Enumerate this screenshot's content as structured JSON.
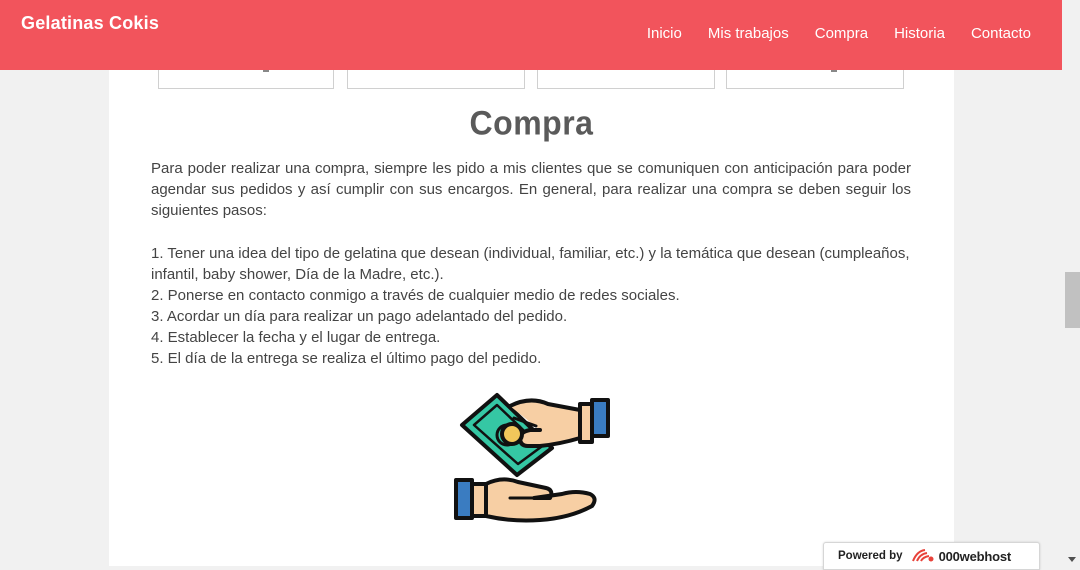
{
  "header": {
    "brand": "Gelatinas Cokis",
    "nav": [
      {
        "label": "Inicio"
      },
      {
        "label": "Mis trabajos"
      },
      {
        "label": "Compra"
      },
      {
        "label": "Historia"
      },
      {
        "label": "Contacto"
      }
    ]
  },
  "section": {
    "title": "Compra",
    "intro": "Para poder realizar una compra, siempre les pido a mis clientes que se comuniquen con anticipación para poder agendar sus pedidos y así cumplir con sus encargos. En general, para realizar una compra se deben seguir los siguientes pasos:",
    "steps": [
      "1. Tener una idea del tipo de gelatina que desean (individual, familiar, etc.) y la temática que desean (cumpleaños, infantil, baby shower, Día de la Madre, etc.).",
      "2. Ponerse en contacto conmigo a través de cualquier medio de redes sociales.",
      "3. Acordar un día para realizar un pago adelantado del pedido.",
      "4. Establecer la fecha y el lugar de entrega.",
      "5. El día de la entrega se realiza el último pago del pedido."
    ],
    "illustration_icon": "hands-money-exchange-icon"
  },
  "footer_badge": {
    "label": "Powered by",
    "brand": "000webhost"
  },
  "colors": {
    "navbar": "#f2545c",
    "title": "#5a5a5a",
    "text": "#444444",
    "money_green": "#35c7a4",
    "coin": "#f1c75b",
    "skin": "#f7cfa4",
    "cuff": "#3a7cc1"
  }
}
